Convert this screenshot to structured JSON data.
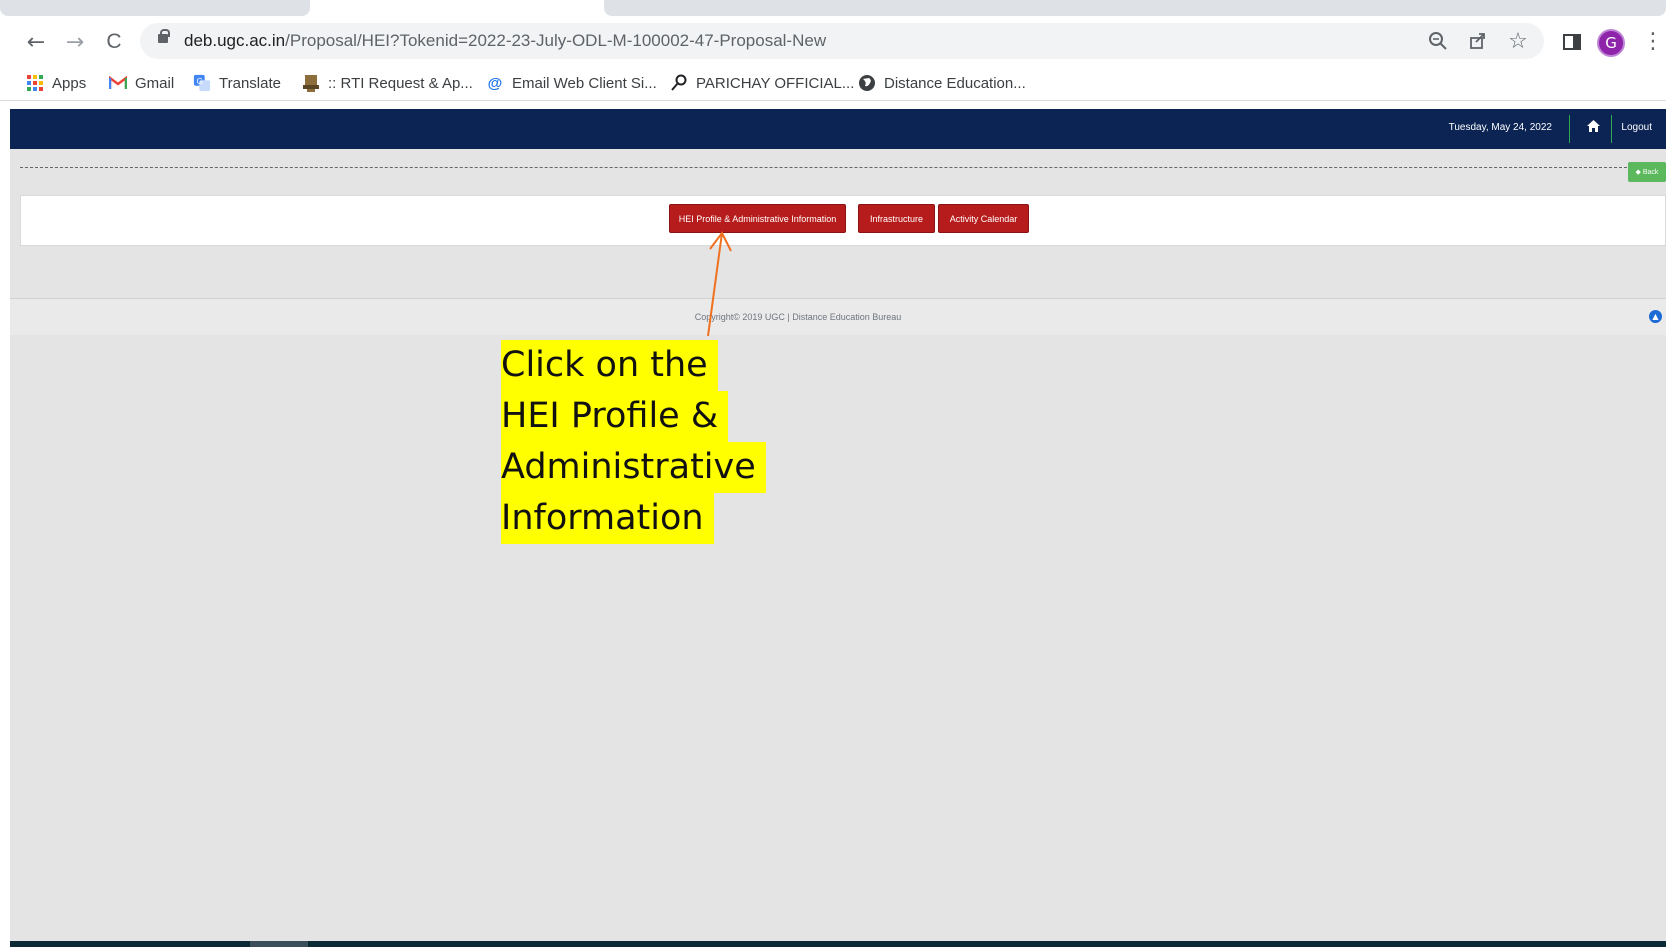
{
  "browser": {
    "url_host": "deb.ugc.ac.in",
    "url_path": "/Proposal/HEI?Tokenid=2022-23-July-ODL-M-100002-47-Proposal-New",
    "profile_initial": "G",
    "nav": {
      "back": "←",
      "forward": "→",
      "reload": "C"
    },
    "icons": {
      "zoom": "zoom-icon",
      "share": "share-icon",
      "bookmark": "star-icon",
      "sidepanel": "side-panel-icon",
      "menu": "kebab-menu-icon"
    }
  },
  "bookmarks": [
    {
      "label": "Apps",
      "icon": "apps-grid-icon"
    },
    {
      "label": "Gmail",
      "icon": "gmail-icon"
    },
    {
      "label": "Translate",
      "icon": "translate-icon"
    },
    {
      "label": ":: RTI Request & Ap...",
      "icon": "emblem-icon"
    },
    {
      "label": "Email Web Client Si...",
      "icon": "at-sign-icon"
    },
    {
      "label": "PARICHAY OFFICIAL...",
      "icon": "key-icon"
    },
    {
      "label": "Distance Education...",
      "icon": "globe-icon"
    }
  ],
  "header": {
    "date": "Tuesday, May 24, 2022",
    "logout": "Logout"
  },
  "back_button": "Back",
  "tabs": [
    {
      "label": "HEI Profile & Administrative Information"
    },
    {
      "label": "Infrastructure"
    },
    {
      "label": "Activity Calendar"
    }
  ],
  "footer": {
    "copyright": "Copyright© 2019 UGC | Distance Education Bureau"
  },
  "annotation": {
    "lines": [
      "Click on the",
      "HEI Profile &",
      "Administrative",
      "Information"
    ]
  },
  "colors": {
    "header_bg": "#0b2454",
    "tab_button": "#b71c1c",
    "back_button": "#5cb85c",
    "annotation_highlight": "#ffff00",
    "arrow": "#f07020"
  }
}
